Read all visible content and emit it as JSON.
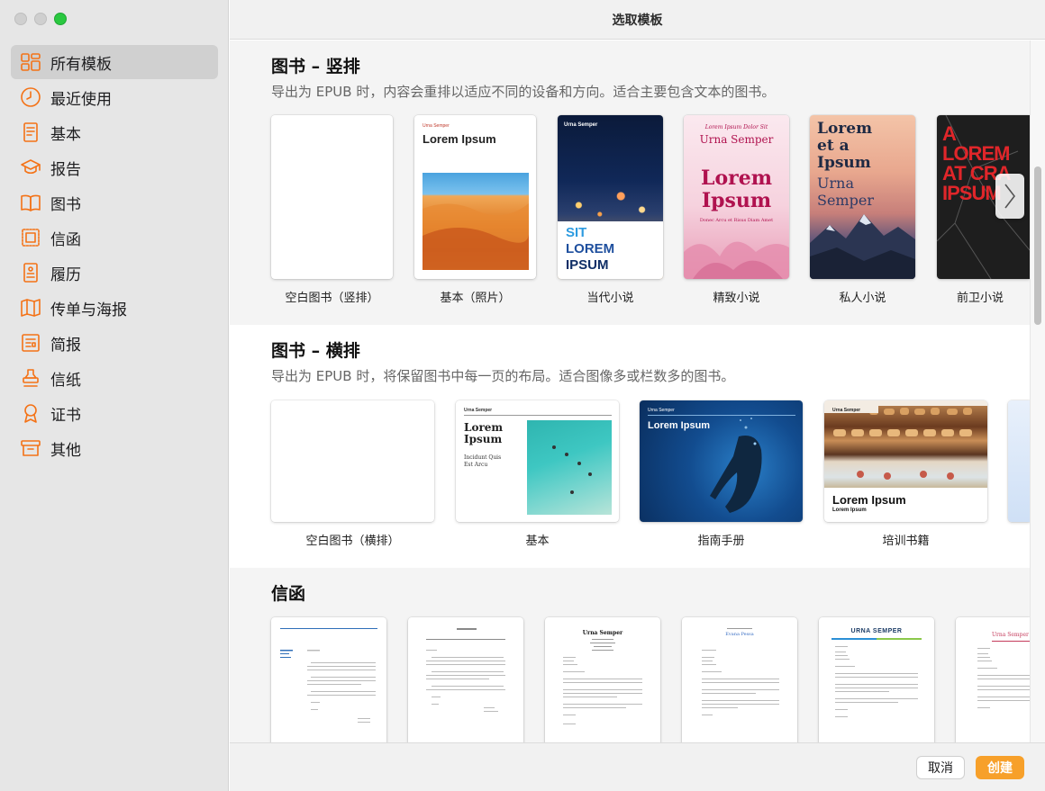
{
  "window": {
    "title": "选取模板"
  },
  "sidebar": {
    "items": [
      {
        "label": "所有模板",
        "icon": "grid-icon",
        "active": true
      },
      {
        "label": "最近使用",
        "icon": "clock-icon"
      },
      {
        "label": "基本",
        "icon": "document-icon"
      },
      {
        "label": "报告",
        "icon": "graduation-cap-icon"
      },
      {
        "label": "图书",
        "icon": "book-icon"
      },
      {
        "label": "信函",
        "icon": "stamp-letter-icon"
      },
      {
        "label": "履历",
        "icon": "resume-icon"
      },
      {
        "label": "传单与海报",
        "icon": "map-poster-icon"
      },
      {
        "label": "简报",
        "icon": "newsletter-icon"
      },
      {
        "label": "信纸",
        "icon": "stationery-stamp-icon"
      },
      {
        "label": "证书",
        "icon": "ribbon-icon"
      },
      {
        "label": "其他",
        "icon": "archive-box-icon"
      }
    ]
  },
  "sections": {
    "portrait": {
      "title": "图书 – 竖排",
      "subtitle": "导出为 EPUB 时，内容会重排以适应不同的设备和方向。适合主要包含文本的图书。",
      "templates": [
        {
          "label": "空白图书（竖排）"
        },
        {
          "label": "基本（照片）",
          "small": "Urna Semper",
          "heading": "Lorem Ipsum"
        },
        {
          "label": "当代小说",
          "small": "Urna Semper",
          "lines": [
            "SIT",
            "LOREM",
            "IPSUM"
          ]
        },
        {
          "label": "精致小说",
          "top": "Lorem Ipsum Dolor Sit",
          "name": "Urna Semper",
          "heading1": "Lorem",
          "heading2": "Ipsum",
          "foot": "Donec Arcu et Risus Diam Amet"
        },
        {
          "label": "私人小说",
          "lines": [
            "Lorem",
            "et a",
            "Ipsum"
          ],
          "sub": [
            "Urna",
            "Semper"
          ]
        },
        {
          "label": "前卫小说",
          "lines": [
            "A",
            "LOREM",
            "AT CRA",
            "IPSUM"
          ]
        }
      ]
    },
    "landscape": {
      "title": "图书 – 横排",
      "subtitle": "导出为 EPUB 时，将保留图书中每一页的布局。适合图像多或栏数多的图书。",
      "templates": [
        {
          "label": "空白图书（横排）"
        },
        {
          "label": "基本",
          "small": "Urna Semper",
          "heading1": "Lorem",
          "heading2": "Ipsum",
          "sub1": "Incidunt Quis",
          "sub2": "Est Arcu"
        },
        {
          "label": "指南手册",
          "small": "Urna Semper",
          "heading": "Lorem Ipsum"
        },
        {
          "label": "培训书籍",
          "small": "Urna Semper",
          "heading": "Lorem Ipsum",
          "sub": "Lorem Ipsum"
        }
      ]
    },
    "letters": {
      "title": "信函",
      "templates": [
        {
          "small": ""
        },
        {
          "small": ""
        },
        {
          "heading": "Urna Semper"
        },
        {
          "heading": "Evana Pessa"
        },
        {
          "heading": "URNA SEMPER"
        },
        {
          "heading": "Urna Semper"
        }
      ]
    }
  },
  "footer": {
    "cancel": "取消",
    "create": "创建"
  },
  "colors": {
    "accent": "#f47216",
    "create_button": "#f7a02a"
  }
}
